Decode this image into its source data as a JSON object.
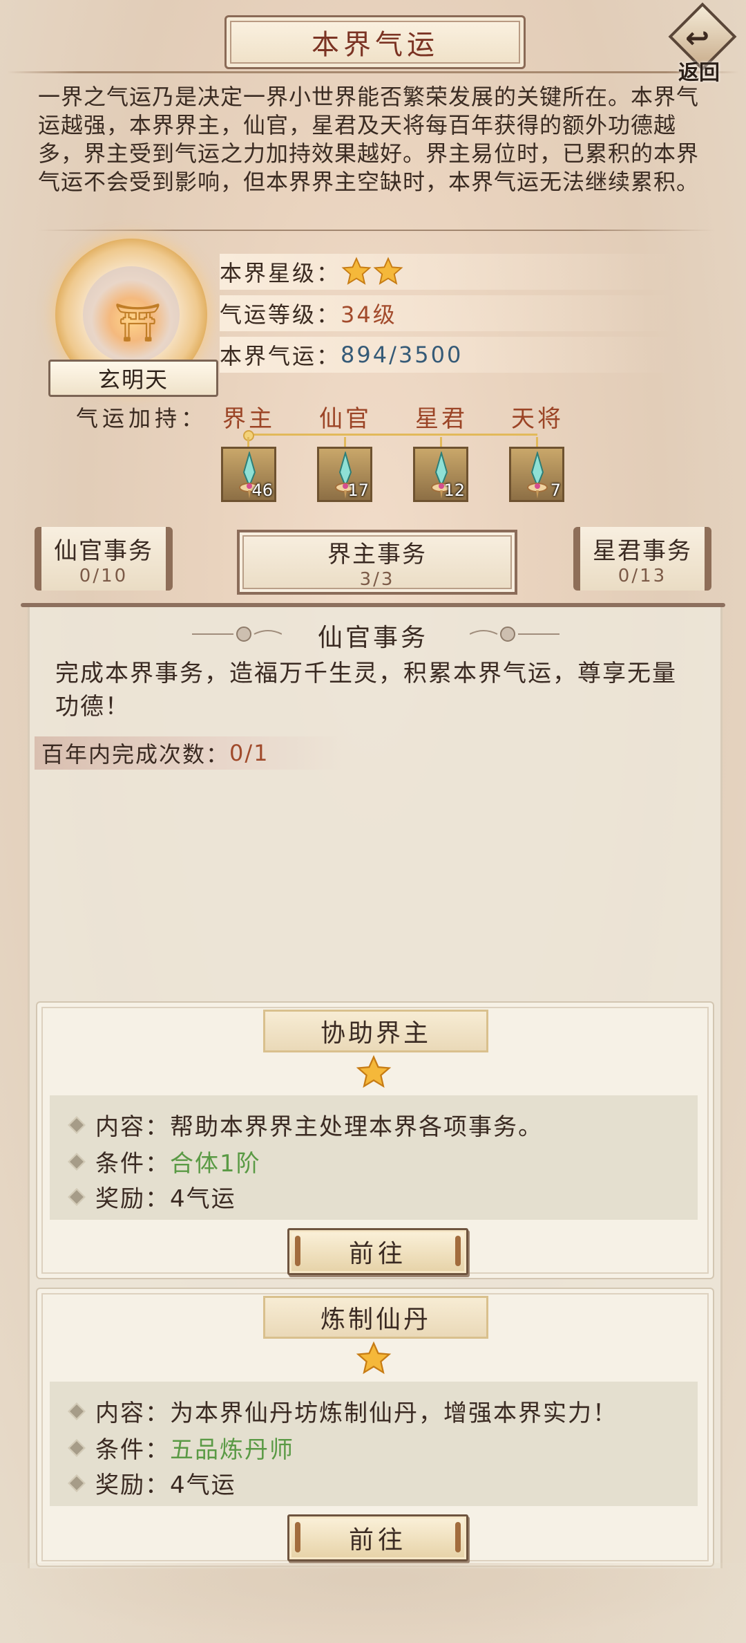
{
  "header": {
    "title": "本界气运",
    "back_label": "返回"
  },
  "description": "一界之气运乃是决定一界小世界能否繁荣发展的关键所在。本界气运越强，本界界主，仙官，星君及天将每百年获得的额外功德越多，界主受到气运之力加持效果越好。界主易位时，已累积的本界气运不会受到影响，但本界界主空缺时，本界气运无法继续累积。",
  "realm": {
    "name": "玄明天",
    "star_label": "本界星级：",
    "stars": 2,
    "level_label": "气运等级：",
    "level_value": "34级",
    "fortune_label": "本界气运：",
    "fortune_value": "894/3500"
  },
  "boost": {
    "label": "气运加持：",
    "items": [
      {
        "title": "界主",
        "count": "46"
      },
      {
        "title": "仙官",
        "count": "17"
      },
      {
        "title": "星君",
        "count": "12"
      },
      {
        "title": "天将",
        "count": "7"
      }
    ]
  },
  "tabs": [
    {
      "label": "仙官事务",
      "count": "0/10"
    },
    {
      "label": "界主事务",
      "count": "3/3"
    },
    {
      "label": "星君事务",
      "count": "0/13"
    }
  ],
  "section": {
    "title": "仙官事务",
    "desc": "完成本界事务，造福万千生灵，积累本界气运，尊享无量功德！",
    "count_label": "百年内完成次数：",
    "count_value": "0/1"
  },
  "tasks": [
    {
      "title": "协助界主",
      "stars": 1,
      "content_label": "内容：",
      "content": "帮助本界界主处理本界各项事务。",
      "cond_label": "条件：",
      "cond": "合体1阶",
      "reward_label": "奖励：",
      "reward": "4气运",
      "button": "前往"
    },
    {
      "title": "炼制仙丹",
      "stars": 1,
      "content_label": "内容：",
      "content": "为本界仙丹坊炼制仙丹，增强本界实力！",
      "cond_label": "条件：",
      "cond": "五品炼丹师",
      "reward_label": "奖励：",
      "reward": "4气运",
      "button": "前往"
    }
  ],
  "colors": {
    "accent_red": "#9b4426",
    "value_blue": "#355a77",
    "condition_green": "#5a9a45",
    "gold": "#e2b95a"
  },
  "icons": [
    "back-icon",
    "star-icon",
    "boost-sword-icon",
    "palace-emblem-icon",
    "bullet-diamond-icon"
  ]
}
